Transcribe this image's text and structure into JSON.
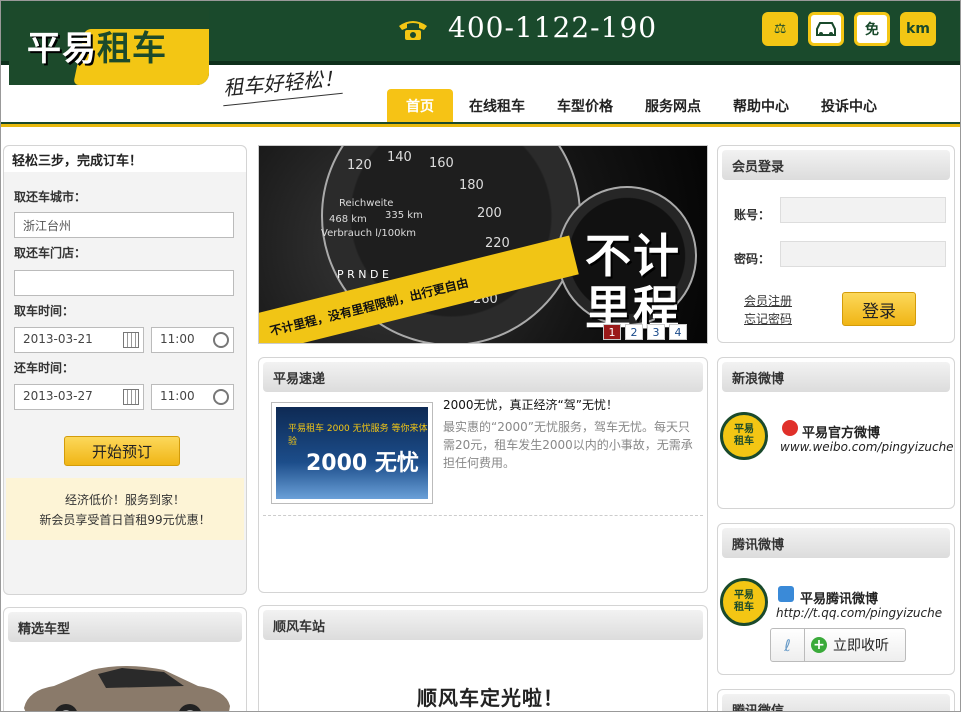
{
  "header": {
    "logo_text_1": "平易",
    "logo_text_2": "租车",
    "slogan": "租车好轻松！",
    "phone": "400-1122-190",
    "icons": [
      {
        "name": "gavel-icon",
        "glyph": "⚖"
      },
      {
        "name": "car-icon",
        "glyph": "🚗"
      },
      {
        "name": "free-icon",
        "glyph": "免"
      },
      {
        "name": "km-icon",
        "glyph": "km"
      }
    ]
  },
  "nav": {
    "items": [
      "首页",
      "在线租车",
      "车型价格",
      "服务网点",
      "帮助中心",
      "投诉中心"
    ]
  },
  "booking": {
    "title": "轻松三步，完成订车！",
    "city_label": "取还车城市：",
    "city_value": "浙江台州",
    "store_label": "取还车门店：",
    "store_value": "",
    "pickup_label": "取车时间：",
    "pickup_date": "2013-03-21",
    "pickup_time": "11:00",
    "return_label": "还车时间：",
    "return_date": "2013-03-27",
    "return_time": "11:00",
    "submit": "开始预订",
    "promo_line1": "经济低价！服务到家！",
    "promo_line2": "新会员享受首日首租99元优惠！"
  },
  "featured": {
    "title": "精选车型"
  },
  "banner": {
    "headline_1": "不计",
    "headline_2": "里程",
    "tape": "不计里程，没有里程限制，出行更自由",
    "gauge_numbers": [
      "120",
      "140",
      "160",
      "180",
      "200",
      "220",
      "240",
      "260"
    ],
    "dash_text_1": "Reichweite",
    "dash_text_2": "468 km",
    "dash_text_3": "335 km",
    "dash_text_4": "Verbrauch l/100km",
    "gear": "P R N D E",
    "pages": [
      "1",
      "2",
      "3",
      "4"
    ],
    "active_page": "1"
  },
  "news": {
    "title": "平易速递",
    "thumb_text": "2000 无忧",
    "thumb_top": "平易租车 2000 无忧服务 等你来体验",
    "item_title": "2000无忧，真正经济“驾”无忧！",
    "item_body": "最实惠的“2000”无忧服务，驾车无忧。每天只需20元，租车发生2000以内的小事故，无需承担任何费用。"
  },
  "ride": {
    "title": "顺风车站",
    "body": "顺风车定光啦！"
  },
  "login": {
    "title": "会员登录",
    "account_label": "账号：",
    "password_label": "密码：",
    "register": "会员注册",
    "forgot": "忘记密码",
    "submit": "登录"
  },
  "sina": {
    "title": "新浪微博",
    "name": "平易官方微博",
    "url": "www.weibo.com/pingyizuche"
  },
  "qq": {
    "title": "腾讯微博",
    "name": "平易腾讯微博",
    "url": "http://t.qq.com/pingyizuche",
    "follow": "立即收听"
  },
  "wechat": {
    "title": "腾讯微信"
  },
  "badge": {
    "line1": "平易",
    "line2": "租车"
  },
  "colors": {
    "brand_green": "#1a4a2c",
    "brand_yellow": "#f3c614",
    "active_page": "#9a1a1a"
  }
}
